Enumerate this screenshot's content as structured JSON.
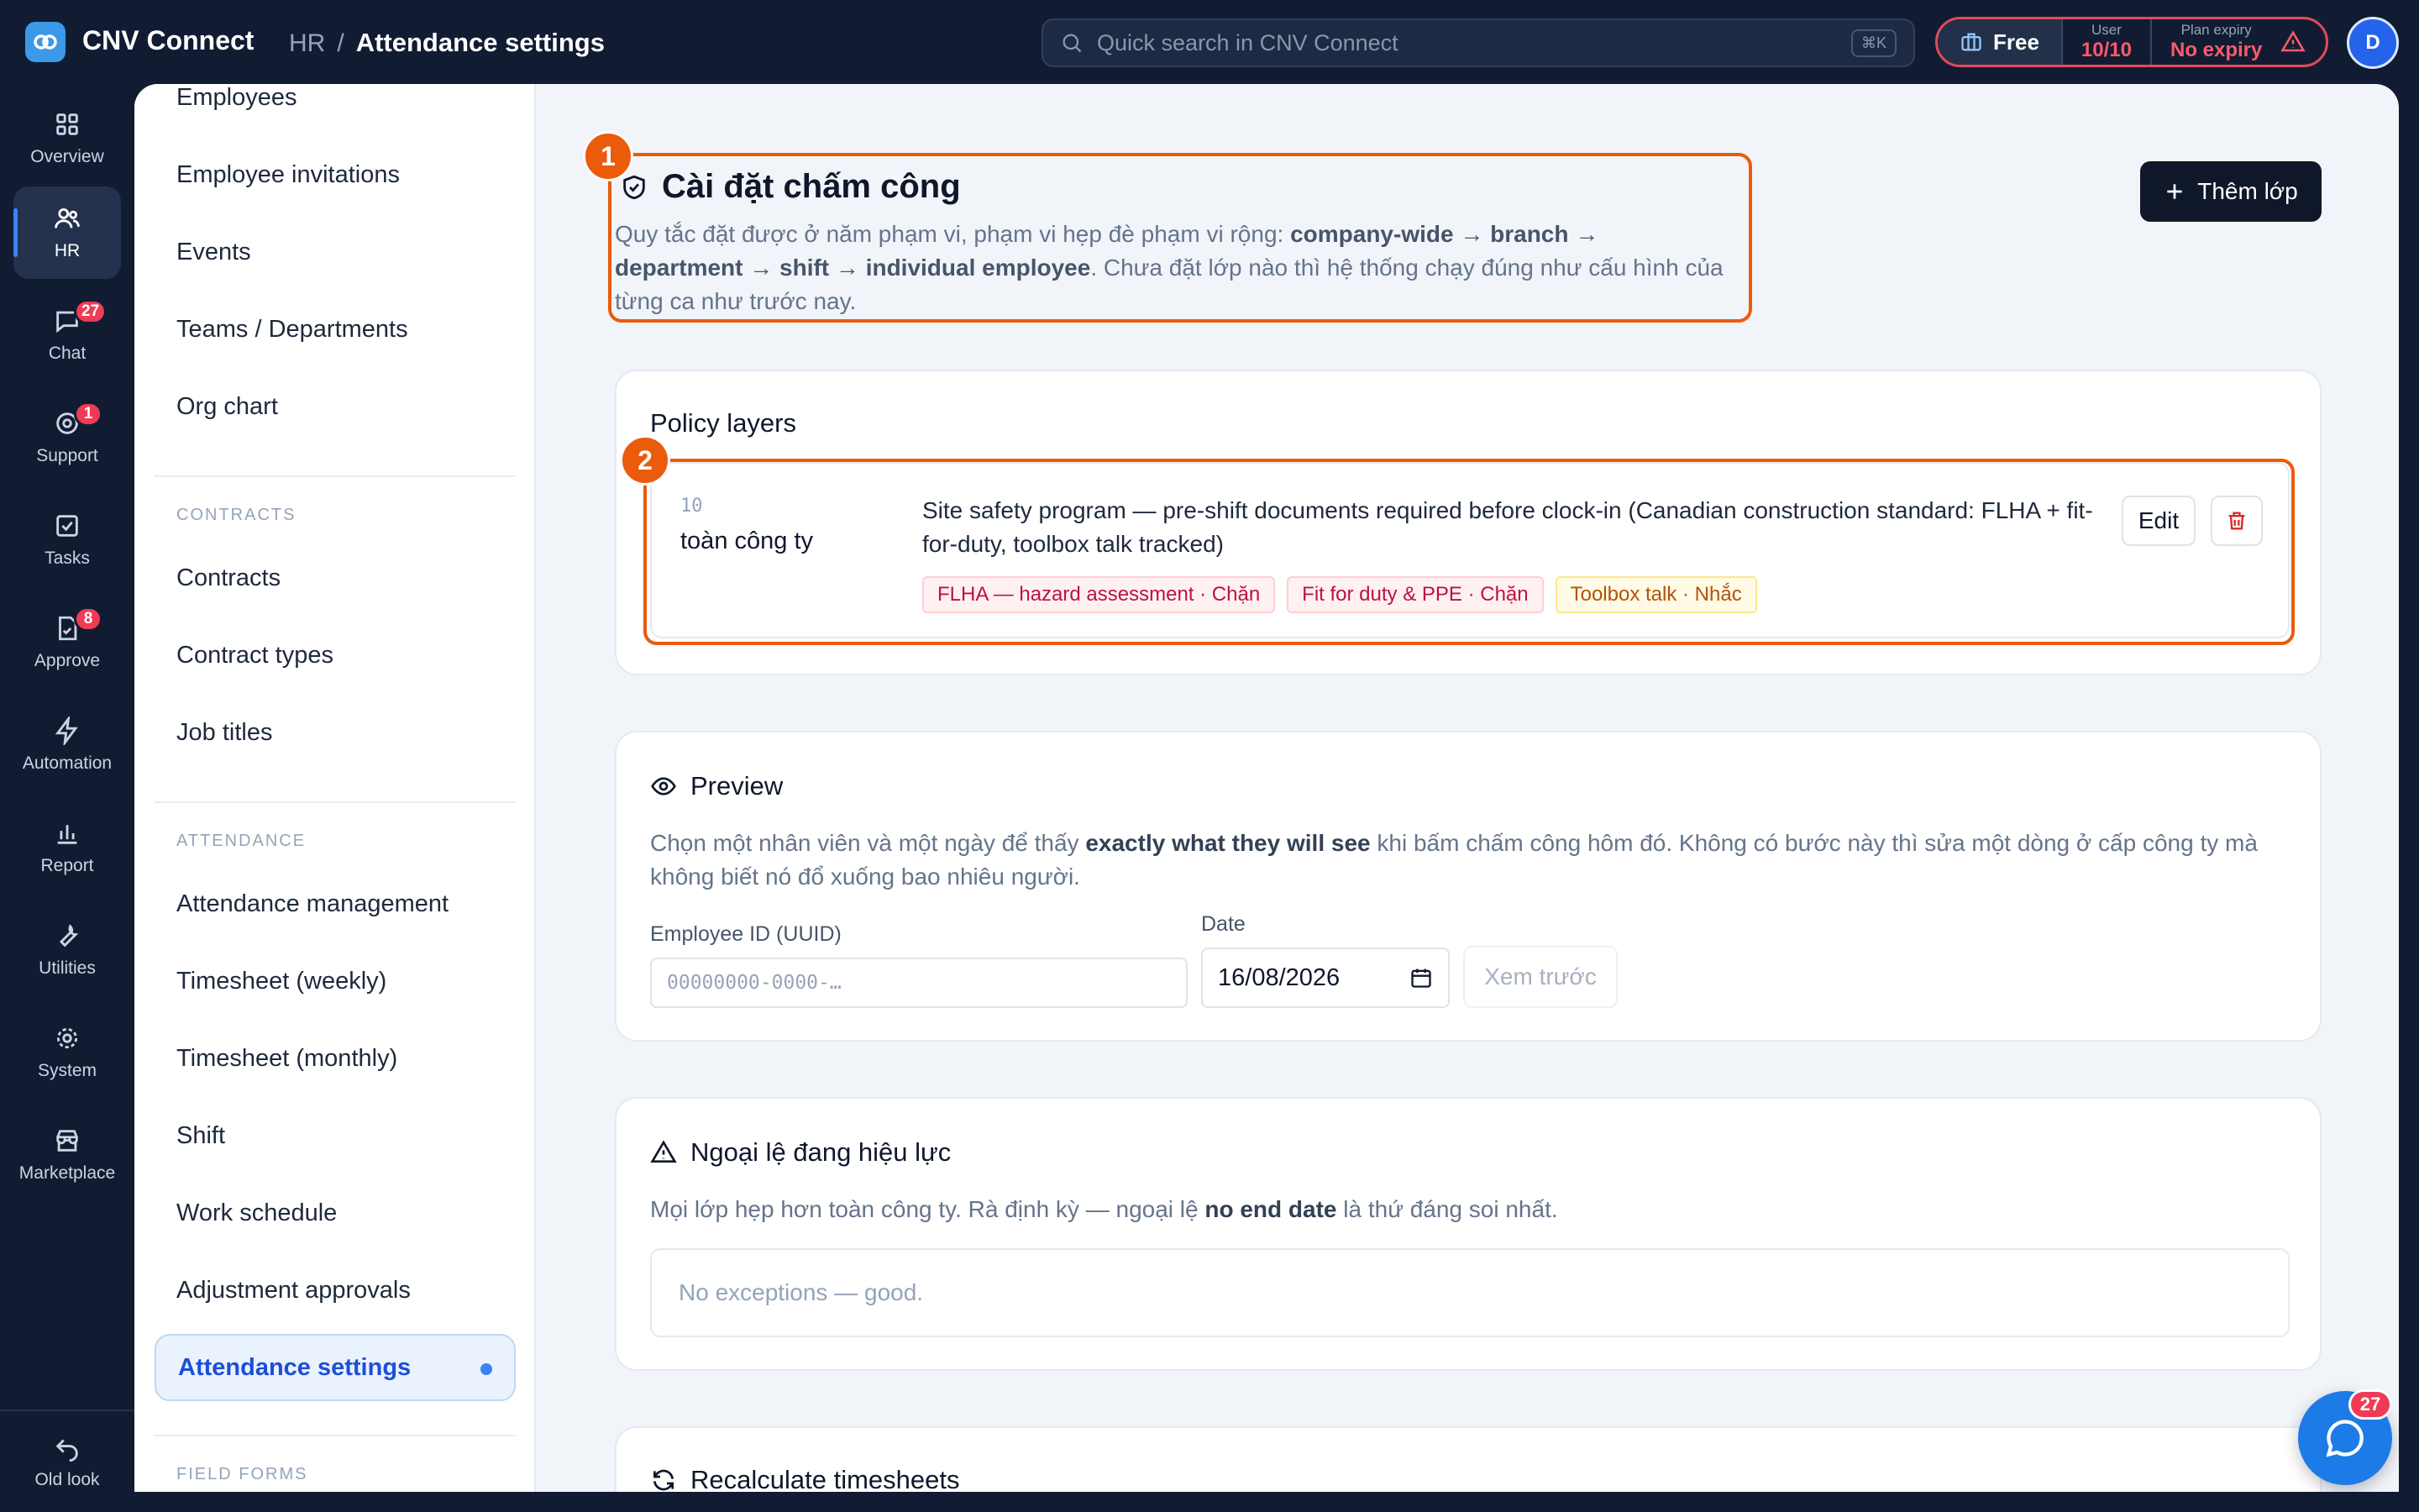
{
  "app": {
    "name": "CNV Connect"
  },
  "breadcrumb": {
    "parent": "HR",
    "separator": "/",
    "current": "Attendance settings"
  },
  "search": {
    "placeholder": "Quick search in CNV Connect",
    "shortcut": "⌘K"
  },
  "plan": {
    "tier": "Free",
    "user_label": "User",
    "user_value": "10/10",
    "expiry_label": "Plan expiry",
    "expiry_value": "No expiry"
  },
  "user": {
    "avatar_initial": "D"
  },
  "rail": {
    "items": [
      {
        "label": "Overview",
        "icon": "grid-icon"
      },
      {
        "label": "HR",
        "icon": "users-icon"
      },
      {
        "label": "Chat",
        "icon": "chat-icon",
        "badge": "27"
      },
      {
        "label": "Support",
        "icon": "support-icon",
        "badge": "1"
      },
      {
        "label": "Tasks",
        "icon": "checkbox-icon"
      },
      {
        "label": "Approve",
        "icon": "approve-icon",
        "badge": "8"
      },
      {
        "label": "Automation",
        "icon": "bolt-icon"
      },
      {
        "label": "Report",
        "icon": "bar-chart-icon"
      },
      {
        "label": "Utilities",
        "icon": "wrench-icon"
      },
      {
        "label": "System",
        "icon": "gear-icon"
      },
      {
        "label": "Marketplace",
        "icon": "store-icon"
      }
    ],
    "old_look": "Old look"
  },
  "subnav": {
    "items": [
      "Employees",
      "Employee invitations",
      "Events",
      "Teams / Departments",
      "Org chart"
    ],
    "contracts_heading": "CONTRACTS",
    "contracts": [
      "Contracts",
      "Contract types",
      "Job titles"
    ],
    "attendance_heading": "ATTENDANCE",
    "attendance": [
      "Attendance management",
      "Timesheet (weekly)",
      "Timesheet (monthly)",
      "Shift",
      "Work schedule",
      "Adjustment approvals",
      "Attendance settings"
    ],
    "field_forms_heading": "FIELD FORMS"
  },
  "page": {
    "title": "Cài đặt chấm công",
    "desc_pre": "Quy tắc đặt được ở năm phạm vi, phạm vi hẹp đè phạm vi rộng: ",
    "desc_bold": "company-wide → branch → department → shift → individual employee",
    "desc_post": ". Chưa đặt lớp nào thì hệ thống chạy đúng như cấu hình của từng ca như trước nay.",
    "add_button": "Thêm lớp"
  },
  "markers": [
    "1",
    "2"
  ],
  "policy": {
    "title": "Policy layers",
    "layer": {
      "priority": "10",
      "scope": "toàn công ty",
      "description": "Site safety program — pre-shift documents required before clock-in (Canadian construction standard: FLHA + fit-for-duty, toolbox talk tracked)",
      "chips": [
        "FLHA — hazard assessment · Chặn",
        "Fit for duty & PPE · Chặn",
        "Toolbox talk · Nhắc"
      ],
      "edit_label": "Edit"
    }
  },
  "preview": {
    "title": "Preview",
    "desc_pre": "Chọn một nhân viên và một ngày để thấy ",
    "desc_bold": "exactly what they will see",
    "desc_post": " khi bấm chấm công hôm đó. Không có bước này thì sửa một dòng ở cấp công ty mà không biết nó đổ xuống bao nhiêu người.",
    "employee_label": "Employee ID (UUID)",
    "employee_placeholder": "00000000-0000-…",
    "date_label": "Date",
    "date_value": "16/08/2026",
    "button": "Xem trước"
  },
  "exceptions": {
    "title": "Ngoại lệ đang hiệu lực",
    "desc_pre": "Mọi lớp hẹp hơn toàn công ty. Rà định kỳ — ngoại lệ ",
    "desc_bold": "no end date",
    "desc_post": " là thứ đáng soi nhất.",
    "empty": "No exceptions — good."
  },
  "recalc": {
    "title": "Recalculate timesheets"
  },
  "chat_fab": {
    "badge": "27"
  },
  "colors": {
    "accent": "#3b82f6",
    "marker": "#ea5b0c",
    "danger": "#ef3b55",
    "sidebar_bg": "#111c33"
  }
}
